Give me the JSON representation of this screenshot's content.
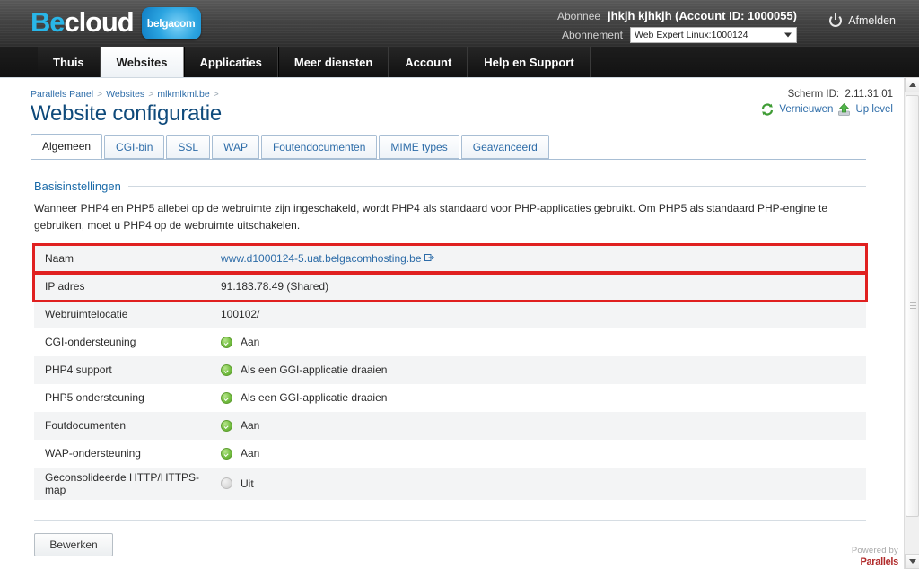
{
  "header": {
    "logo": {
      "part1": "Be",
      "part2": "cloud",
      "badge": "belgacom"
    },
    "subscriber_label": "Abonnee",
    "subscriber_value": "jhkjh kjhkjh (Account ID: 1000055)",
    "subscription_label": "Abonnement",
    "subscription_selected": "Web Expert Linux:1000124",
    "logout_label": "Afmelden"
  },
  "mainnav": {
    "items": [
      {
        "label": "Thuis",
        "active": false
      },
      {
        "label": "Websites",
        "active": true
      },
      {
        "label": "Applicaties",
        "active": false
      },
      {
        "label": "Meer diensten",
        "active": false
      },
      {
        "label": "Account",
        "active": false
      },
      {
        "label": "Help en Support",
        "active": false
      }
    ]
  },
  "breadcrumb": {
    "items": [
      "Parallels Panel",
      "Websites",
      "mlkmlkml.be"
    ],
    "separator": ">"
  },
  "page": {
    "title": "Website configuratie",
    "screen_id_label": "Scherm ID:",
    "screen_id_value": "2.11.31.01",
    "refresh_label": "Vernieuwen",
    "uplevel_label": "Up level"
  },
  "tabs": [
    {
      "label": "Algemeen",
      "active": true
    },
    {
      "label": "CGI-bin",
      "active": false
    },
    {
      "label": "SSL",
      "active": false
    },
    {
      "label": "WAP",
      "active": false
    },
    {
      "label": "Foutendocumenten",
      "active": false
    },
    {
      "label": "MIME types",
      "active": false
    },
    {
      "label": "Geavanceerd",
      "active": false
    }
  ],
  "section": {
    "title": "Basisinstellingen",
    "description": "Wanneer PHP4 en PHP5 allebei op de webruimte zijn ingeschakeld, wordt PHP4 als standaard voor PHP-applicaties gebruikt. Om PHP5 als standaard PHP-engine te gebruiken, moet u PHP4 op de webruimte uitschakelen."
  },
  "properties": [
    {
      "key": "Naam",
      "value": "www.d1000124-5.uat.belgacomhosting.be",
      "type": "link",
      "highlighted": true,
      "external_icon": true
    },
    {
      "key": "IP adres",
      "value": "91.183.78.49 (Shared)",
      "type": "text",
      "highlighted": true
    },
    {
      "key": "Webruimtelocatie",
      "value": "100102/",
      "type": "text",
      "highlighted": false
    },
    {
      "key": "CGI-ondersteuning",
      "value": "Aan",
      "type": "status-on",
      "highlighted": false
    },
    {
      "key": "PHP4 support",
      "value": "Als een GGI-applicatie draaien",
      "type": "status-on",
      "highlighted": false
    },
    {
      "key": "PHP5 ondersteuning",
      "value": "Als een GGI-applicatie draaien",
      "type": "status-on",
      "highlighted": false
    },
    {
      "key": "Foutdocumenten",
      "value": "Aan",
      "type": "status-on",
      "highlighted": false
    },
    {
      "key": "WAP-ondersteuning",
      "value": "Aan",
      "type": "status-on",
      "highlighted": false
    },
    {
      "key": "Geconsolideerde HTTP/HTTPS-map",
      "value": "Uit",
      "type": "status-off",
      "highlighted": false
    }
  ],
  "actions": {
    "edit_label": "Bewerken"
  },
  "footer": {
    "powered_by": "Powered by",
    "brand": "Parallels"
  },
  "colors": {
    "accent_blue": "#2d6ca8",
    "title_blue": "#0f4a7b",
    "logo_cyan": "#29b6e8",
    "highlight_red": "#e02020",
    "status_green": "#76c043",
    "status_grey": "#c9c9c9"
  }
}
